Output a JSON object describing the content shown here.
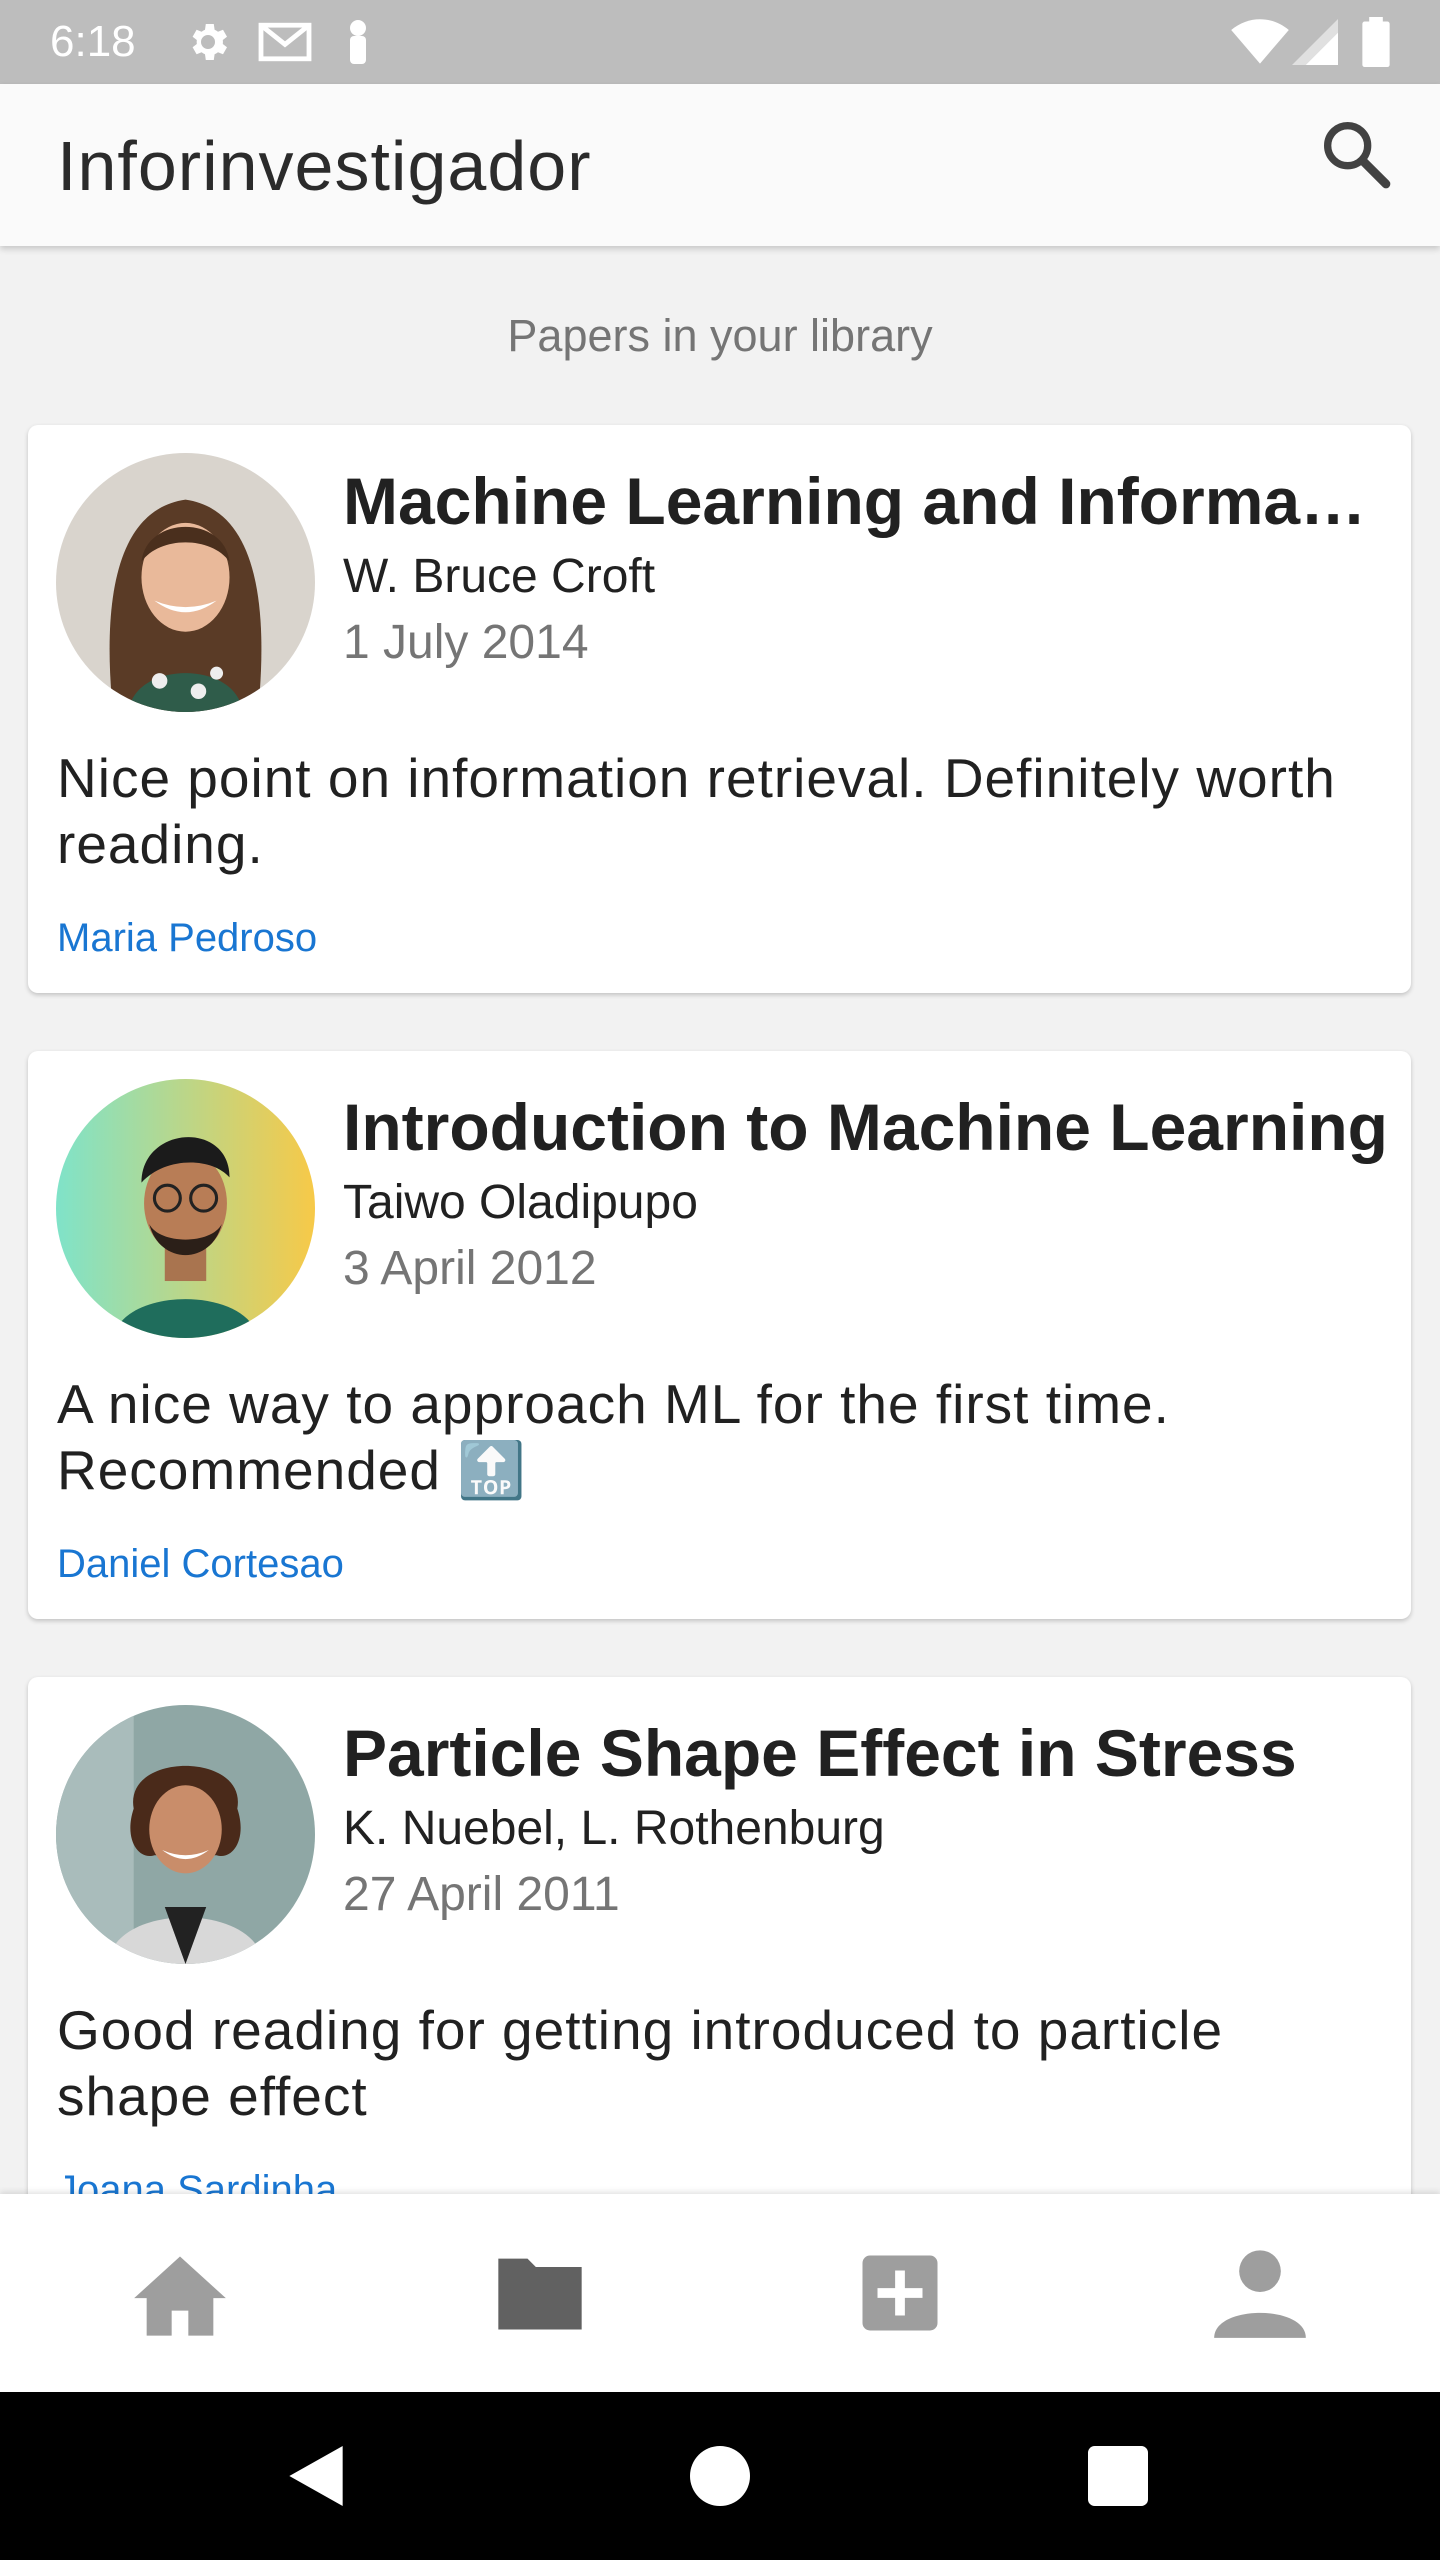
{
  "status_bar": {
    "time": "6:18"
  },
  "app_bar": {
    "title": "Inforinvestigador"
  },
  "section_label": "Papers in your library",
  "papers": [
    {
      "title": "Machine Learning and Information Retrieval",
      "authors": "W. Bruce Croft",
      "date": "1 July 2014",
      "review": "Nice point on information retrieval. Definitely worth reading.",
      "reviewer": "Maria Pedroso"
    },
    {
      "title": "Introduction to Machine Learning",
      "authors": "Taiwo Oladipupo",
      "date": "3 April 2012",
      "review": "A nice way to approach ML for the first time. Recommended 🔝",
      "reviewer": "Daniel Cortesao"
    },
    {
      "title": "Particle Shape Effect in Stress",
      "authors": "K. Nuebel, L. Rothenburg",
      "date": "27 April 2011",
      "review": "Good reading for getting introduced to particle shape effect",
      "reviewer": "Joana Sardinha"
    }
  ],
  "colors": {
    "link": "#1976d2",
    "nav_active": "#616161",
    "nav_inactive": "#9e9e9e"
  }
}
